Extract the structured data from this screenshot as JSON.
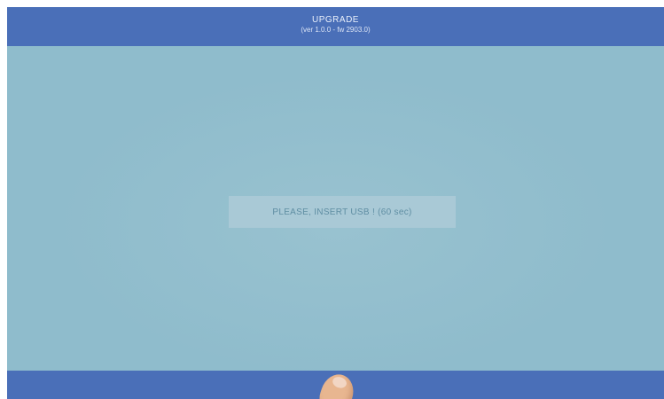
{
  "header": {
    "title": "UPGRADE",
    "subtitle": "(ver 1.0.0 - fw 2903.0)"
  },
  "main": {
    "message": "PLEASE, INSERT USB ! (60 sec)"
  },
  "colors": {
    "bar": "#4a6fb8",
    "background": "#8fbccc",
    "message_box": "#a9c9d6",
    "message_text": "#5f8ea3"
  }
}
